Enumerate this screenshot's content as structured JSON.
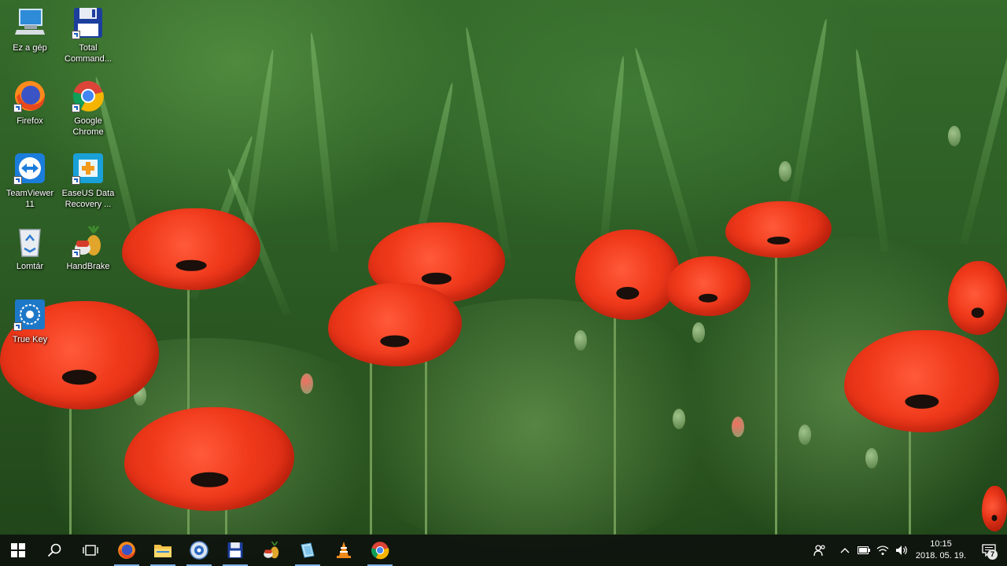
{
  "desktop": {
    "wallpaper": "green grass field with red poppies",
    "icons": [
      {
        "label": "Ez a gép",
        "icon": "computer-icon"
      },
      {
        "label": "Total\nCommand...",
        "icon": "total-commander-floppy-icon"
      },
      {
        "label": "Firefox",
        "icon": "firefox-icon"
      },
      {
        "label": "Google\nChrome",
        "icon": "chrome-icon"
      },
      {
        "label": "TeamViewer\n11",
        "icon": "teamviewer-icon"
      },
      {
        "label": "EaseUS Data\nRecovery ...",
        "icon": "easeus-icon"
      },
      {
        "label": "Lomtár",
        "icon": "recycle-bin-icon"
      },
      {
        "label": "HandBrake",
        "icon": "handbrake-icon"
      },
      {
        "label": "True Key",
        "icon": "true-key-icon"
      }
    ]
  },
  "taskbar": {
    "pinned": [
      {
        "name": "start-button",
        "icon": "windows-logo-icon"
      },
      {
        "name": "search-button",
        "icon": "search-icon"
      },
      {
        "name": "task-view-button",
        "icon": "task-view-icon"
      },
      {
        "name": "firefox",
        "icon": "firefox-icon"
      },
      {
        "name": "file-explorer",
        "icon": "folder-icon"
      },
      {
        "name": "app-circle",
        "icon": "blue-circle-app-icon"
      },
      {
        "name": "total-commander",
        "icon": "floppy-icon"
      },
      {
        "name": "handbrake",
        "icon": "handbrake-icon"
      },
      {
        "name": "notepad-like",
        "icon": "blue-document-icon"
      },
      {
        "name": "vlc",
        "icon": "vlc-cone-icon"
      },
      {
        "name": "chrome",
        "icon": "chrome-icon"
      }
    ],
    "tray": {
      "people_icon": "people-icon",
      "overflow_icon": "chevron-up-icon",
      "battery_icon": "battery-icon",
      "wifi_icon": "wifi-icon",
      "volume_icon": "volume-icon",
      "time": "10:15",
      "date": "2018. 05. 19.",
      "notification_icon": "notification-icon",
      "notification_count": "7"
    }
  },
  "colors": {
    "taskbar": "#0e120e",
    "accent": "#7db3e8",
    "poppy": "#f0391b"
  }
}
